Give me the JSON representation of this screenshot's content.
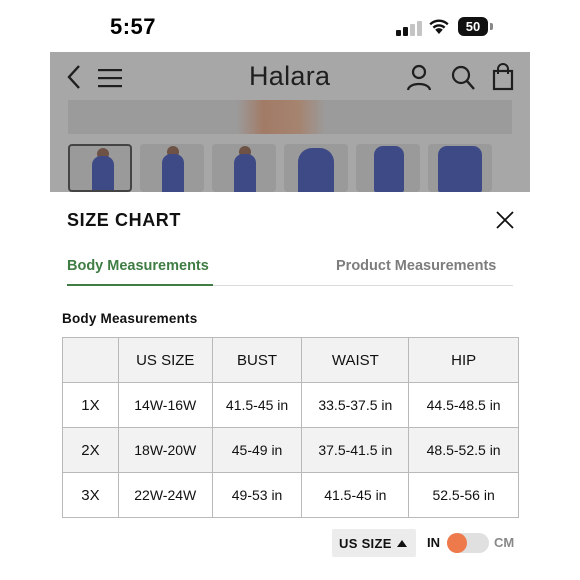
{
  "status_bar": {
    "time": "5:57",
    "battery": "50"
  },
  "site": {
    "logo": "Halara"
  },
  "size_chart": {
    "title": "SIZE CHART",
    "tabs": [
      {
        "label": "Body Measurements",
        "active": true
      },
      {
        "label": "Product Measurements",
        "active": false
      }
    ],
    "section_label": "Body Measurements",
    "table": {
      "headers": [
        "",
        "US SIZE",
        "BUST",
        "WAIST",
        "HIP"
      ],
      "rows": [
        [
          "1X",
          "14W-16W",
          "41.5-45 in",
          "33.5-37.5 in",
          "44.5-48.5 in"
        ],
        [
          "2X",
          "18W-20W",
          "45-49 in",
          "37.5-41.5 in",
          "48.5-52.5 in"
        ],
        [
          "3X",
          "22W-24W",
          "49-53 in",
          "41.5-45 in",
          "52.5-56 in"
        ]
      ]
    },
    "size_system_select": "US SIZE",
    "unit_toggle": {
      "left_label": "IN",
      "right_label": "CM",
      "selected": "IN"
    }
  },
  "colors": {
    "accent_green": "#3f7d45",
    "toggle_knob": "#ee7a4c",
    "overlay_gray": "#a7a7a7"
  }
}
